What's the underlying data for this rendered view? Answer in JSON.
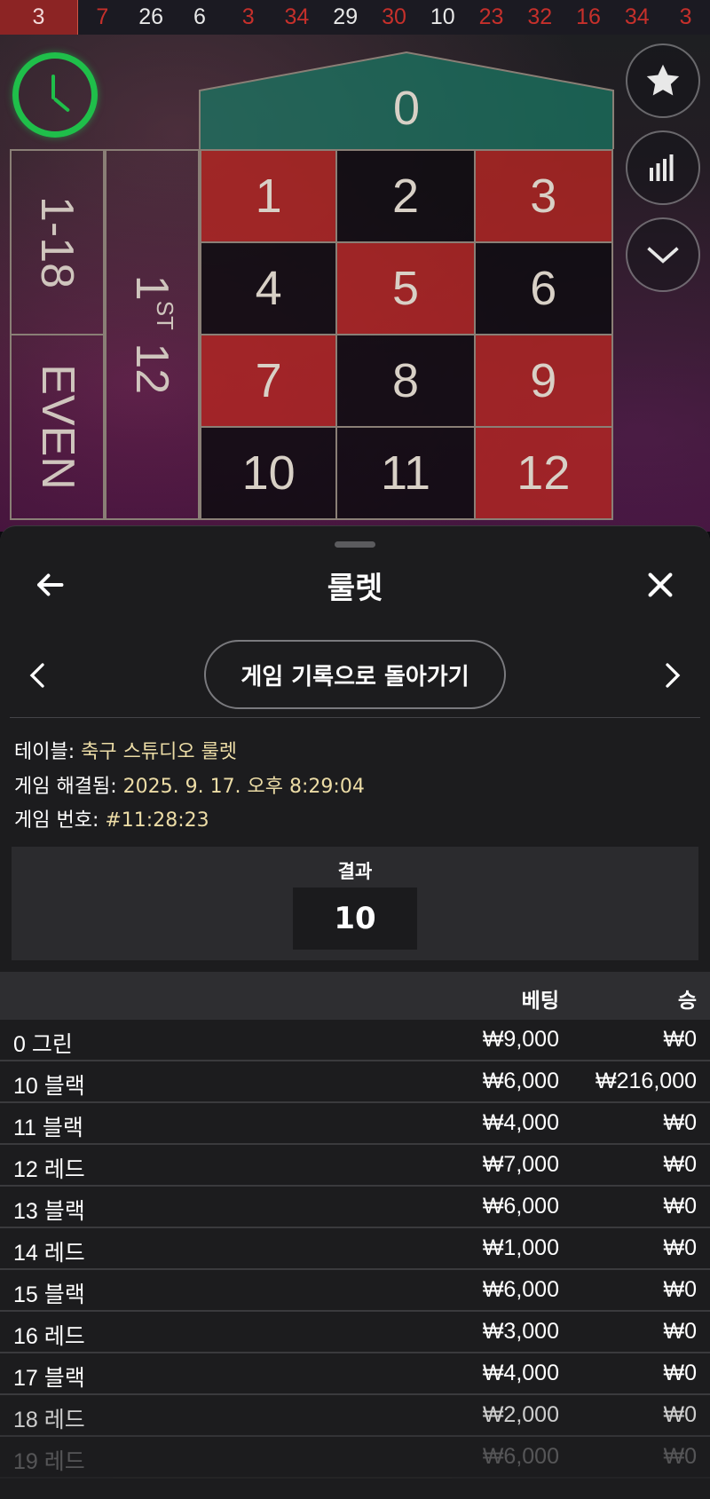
{
  "history": {
    "current": "3",
    "numbers": [
      {
        "value": "7",
        "color": "red"
      },
      {
        "value": "26",
        "color": "black"
      },
      {
        "value": "6",
        "color": "black"
      },
      {
        "value": "3",
        "color": "red"
      },
      {
        "value": "34",
        "color": "red"
      },
      {
        "value": "29",
        "color": "black"
      },
      {
        "value": "30",
        "color": "red"
      },
      {
        "value": "10",
        "color": "black"
      },
      {
        "value": "23",
        "color": "red"
      },
      {
        "value": "32",
        "color": "red"
      },
      {
        "value": "16",
        "color": "red"
      },
      {
        "value": "34",
        "color": "red"
      },
      {
        "value": "3",
        "color": "red"
      }
    ]
  },
  "board": {
    "zero": "0",
    "numbers": [
      {
        "n": "1",
        "color": "red"
      },
      {
        "n": "2",
        "color": "black"
      },
      {
        "n": "3",
        "color": "red"
      },
      {
        "n": "4",
        "color": "black"
      },
      {
        "n": "5",
        "color": "red"
      },
      {
        "n": "6",
        "color": "black"
      },
      {
        "n": "7",
        "color": "red"
      },
      {
        "n": "8",
        "color": "black"
      },
      {
        "n": "9",
        "color": "red"
      },
      {
        "n": "10",
        "color": "black"
      },
      {
        "n": "11",
        "color": "black"
      },
      {
        "n": "12",
        "color": "red"
      }
    ],
    "low_label": "1-18",
    "even_label": "EVEN",
    "dozen_num": "1",
    "dozen_sup": "ST",
    "dozen_rest": " 12"
  },
  "side_buttons": {
    "favorite_icon": "star-icon",
    "stats_icon": "bar-chart-icon",
    "collapse_icon": "chevron-down-icon"
  },
  "timer_icon": "clock-icon",
  "sheet": {
    "title": "룰렛",
    "back_link": "게임 기록으로 돌아가기",
    "meta": {
      "table_label": "테이블: ",
      "table_value": "축구 스튜디오 룰렛",
      "resolved_label": "게임 해결됨: ",
      "resolved_value": "2025. 9. 17. 오후 8:29:04",
      "game_no_label": "게임 번호: ",
      "game_no_value": "#11:28:23"
    },
    "result_label": "결과",
    "result_value": "10",
    "columns": {
      "bet": "베팅",
      "win": "승"
    },
    "rows": [
      {
        "name": "0 그린",
        "bet": "₩9,000",
        "win": "₩0"
      },
      {
        "name": "10 블랙",
        "bet": "₩6,000",
        "win": "₩216,000"
      },
      {
        "name": "11 블랙",
        "bet": "₩4,000",
        "win": "₩0"
      },
      {
        "name": "12 레드",
        "bet": "₩7,000",
        "win": "₩0"
      },
      {
        "name": "13 블랙",
        "bet": "₩6,000",
        "win": "₩0"
      },
      {
        "name": "14 레드",
        "bet": "₩1,000",
        "win": "₩0"
      },
      {
        "name": "15 블랙",
        "bet": "₩6,000",
        "win": "₩0"
      },
      {
        "name": "16 레드",
        "bet": "₩3,000",
        "win": "₩0"
      },
      {
        "name": "17 블랙",
        "bet": "₩4,000",
        "win": "₩0"
      },
      {
        "name": "18 레드",
        "bet": "₩2,000",
        "win": "₩0"
      },
      {
        "name": "19 레드",
        "bet": "₩6,000",
        "win": "₩0"
      }
    ]
  }
}
